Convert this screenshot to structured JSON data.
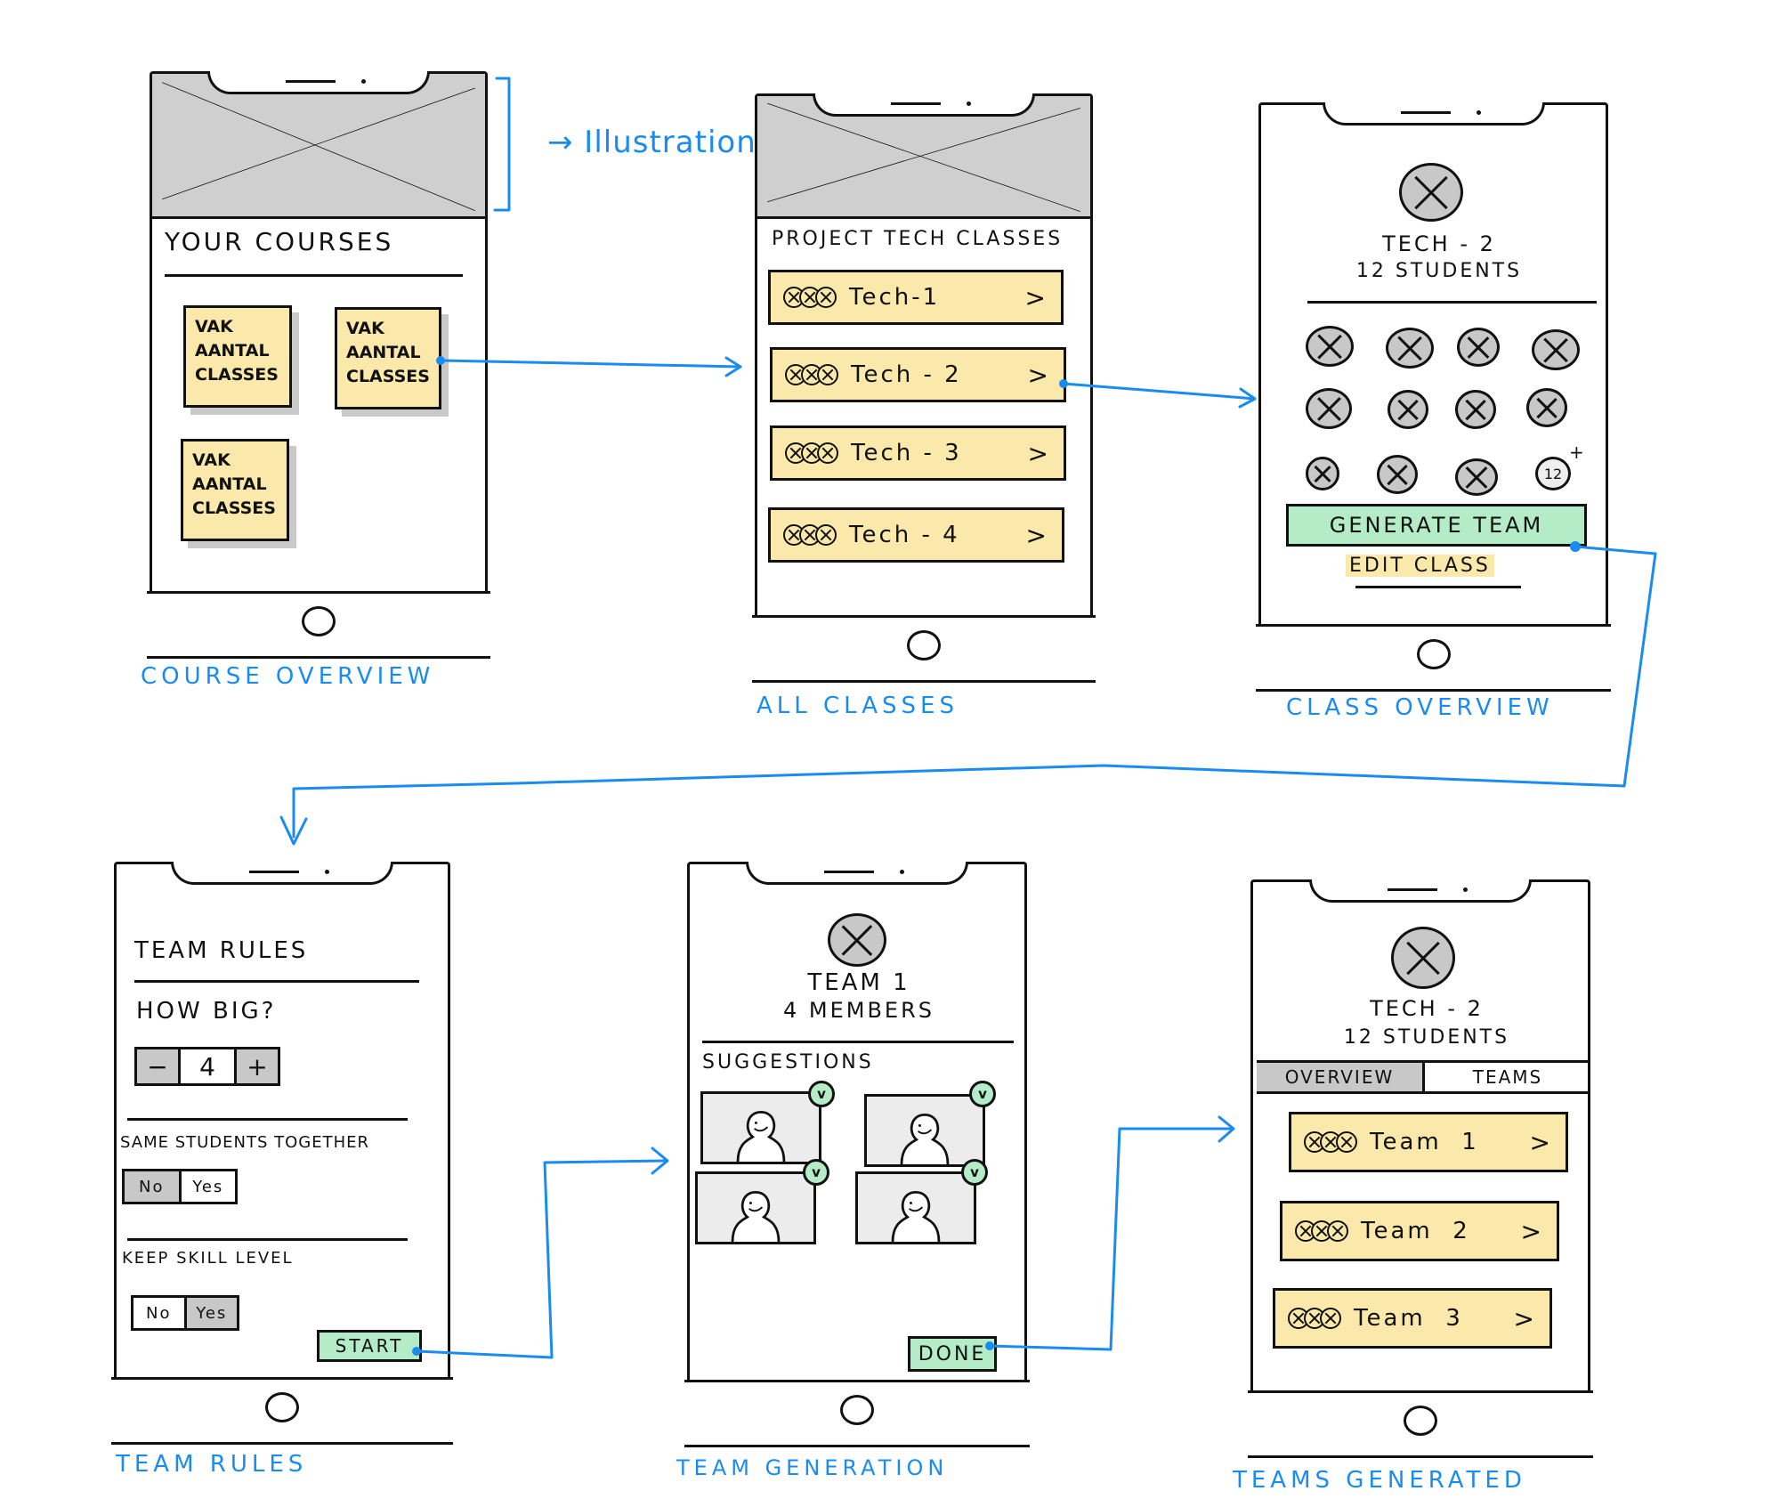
{
  "annotation": {
    "illustration": "Illustration"
  },
  "colors": {
    "flow_blue": "#1a8cf0",
    "card_yellow": "#fbe9ac",
    "button_green": "#b3ecc6",
    "placeholder_gray": "#c8c8c8"
  },
  "screens": {
    "course_overview": {
      "label": "Course   Overview",
      "title": "Your Courses",
      "cards": [
        {
          "line1": "VAK",
          "line2": "AANTAL",
          "line3": "CLASSES"
        },
        {
          "line1": "VAK",
          "line2": "AANTAL",
          "line3": "CLASSES"
        },
        {
          "line1": "VAK",
          "line2": "AANTAL",
          "line3": "CLASSES"
        }
      ]
    },
    "all_classes": {
      "label": "All   Classes",
      "title": "Project Tech Classes",
      "rows": [
        {
          "name": "Tech-1",
          "chevron": ">"
        },
        {
          "name": "Tech - 2",
          "chevron": ">"
        },
        {
          "name": "Tech - 3",
          "chevron": ">"
        },
        {
          "name": "Tech - 4",
          "chevron": ">"
        }
      ]
    },
    "class_overview": {
      "label": "Class   Overview",
      "class_name": "Tech - 2",
      "student_count": "12 Students",
      "more_count": "12",
      "more_plus": "+",
      "generate_button": "Generate Team",
      "edit_link": "Edit Class"
    },
    "team_rules": {
      "label": "Team   Rules",
      "title": "Team Rules",
      "size_question": "How big?",
      "stepper": {
        "minus": "−",
        "value": "4",
        "plus": "+"
      },
      "same_students_label": "Same students together",
      "same_students": {
        "no": "No",
        "yes": "Yes",
        "selected": "No"
      },
      "skill_label": "Keep skill level",
      "skill": {
        "no": "No",
        "yes": "Yes",
        "selected": "Yes"
      },
      "start_button": "Start"
    },
    "team_generation": {
      "label": "Team   Generation",
      "team_name": "Team 1",
      "member_count": "4 Members",
      "section_title": "Suggestions",
      "check_glyph": "v",
      "done_button": "Done"
    },
    "teams_generated": {
      "label": "Teams   Generated",
      "class_name": "Tech - 2",
      "student_count": "12 Students",
      "tabs": [
        {
          "label": "Overview",
          "active": true
        },
        {
          "label": "Teams",
          "active": false
        }
      ],
      "rows": [
        {
          "name": "Team  1",
          "chevron": ">"
        },
        {
          "name": "Team  2",
          "chevron": ">"
        },
        {
          "name": "Team  3",
          "chevron": ">"
        }
      ]
    }
  }
}
